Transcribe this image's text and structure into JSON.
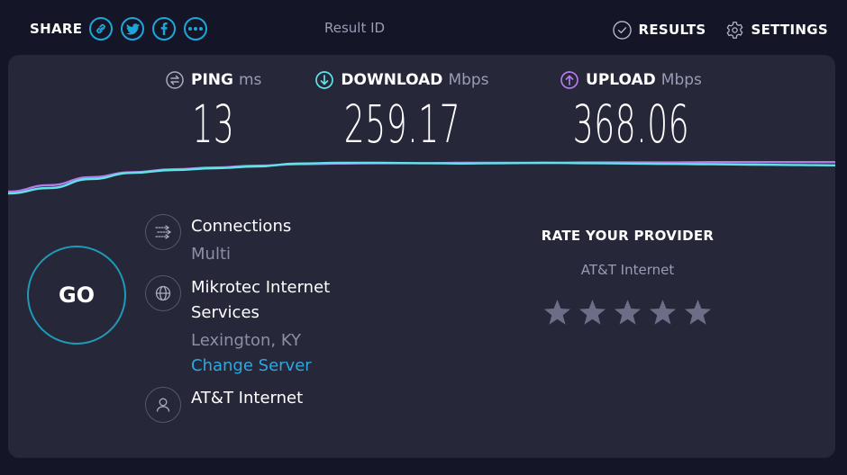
{
  "header": {
    "share_label": "SHARE",
    "share_buttons": [
      {
        "icon": "link-icon"
      },
      {
        "icon": "twitter-icon"
      },
      {
        "icon": "facebook-icon"
      },
      {
        "icon": "more-icon"
      }
    ],
    "result_id_label": "Result ID",
    "results_label": "RESULTS",
    "settings_label": "SETTINGS"
  },
  "metrics": {
    "ping": {
      "label": "PING",
      "unit": "ms",
      "value": "13",
      "icon": "ping-icon"
    },
    "download": {
      "label": "DOWNLOAD",
      "unit": "Mbps",
      "value": "259.17",
      "icon": "download-arrow-icon"
    },
    "upload": {
      "label": "UPLOAD",
      "unit": "Mbps",
      "value": "368.06",
      "icon": "upload-arrow-icon"
    }
  },
  "colors": {
    "download": "#5fe3e8",
    "upload": "#b17ae8",
    "accent": "#1fa6d9",
    "link": "#2ca8e3"
  },
  "speed_graph": {
    "download_series": [
      0.05,
      0.2,
      0.45,
      0.62,
      0.7,
      0.75,
      0.8,
      0.88,
      0.9,
      0.9,
      0.89,
      0.88,
      0.89,
      0.9,
      0.89,
      0.88,
      0.87,
      0.86,
      0.85,
      0.84,
      0.83
    ],
    "upload_series": [
      0.1,
      0.28,
      0.5,
      0.64,
      0.72,
      0.77,
      0.82,
      0.86,
      0.88,
      0.89,
      0.89,
      0.9,
      0.9,
      0.9,
      0.91,
      0.91,
      0.91,
      0.92,
      0.92,
      0.92,
      0.92
    ]
  },
  "go_button": {
    "label": "GO"
  },
  "connections": {
    "label": "Connections",
    "value": "Multi"
  },
  "server": {
    "name_line1": "Mikrotec Internet",
    "name_line2": "Services",
    "location": "Lexington, KY",
    "change_label": "Change Server"
  },
  "isp": {
    "name": "AT&T Internet"
  },
  "rating": {
    "title": "RATE YOUR PROVIDER",
    "provider": "AT&T Internet",
    "stars_total": 5,
    "stars_selected": 0
  }
}
